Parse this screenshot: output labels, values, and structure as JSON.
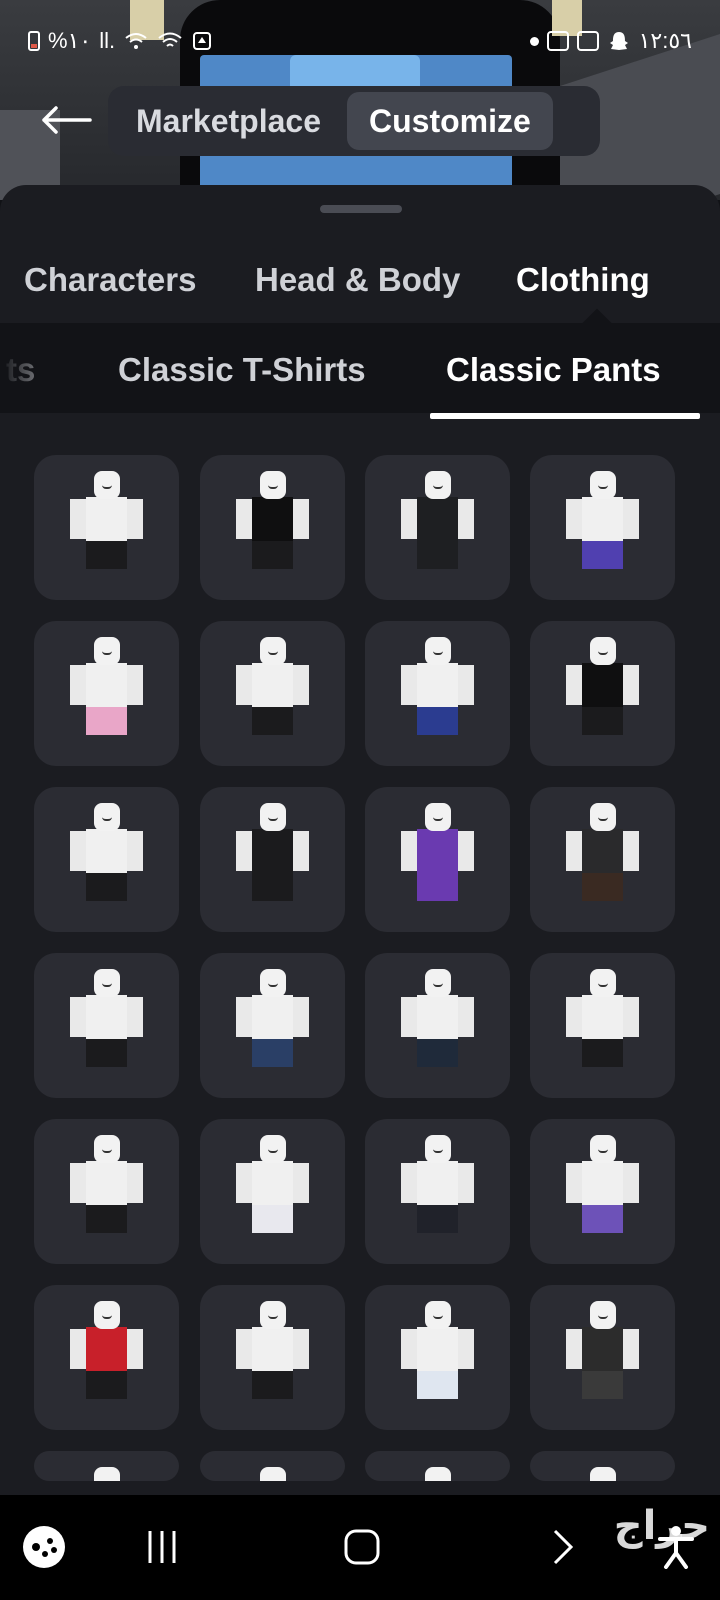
{
  "status_bar": {
    "battery_text": "%١٠",
    "signal_text": "ll.",
    "time": "١٢:٥٦"
  },
  "header": {
    "back_icon": "arrow-left-icon",
    "tabs": [
      {
        "label": "Marketplace",
        "active": false
      },
      {
        "label": "Customize",
        "active": true
      }
    ]
  },
  "categories": [
    {
      "label": "Characters",
      "active": false
    },
    {
      "label": "Head & Body",
      "active": false
    },
    {
      "label": "Clothing",
      "active": true
    }
  ],
  "subcategories": [
    {
      "label": "ts",
      "active": false
    },
    {
      "label": "Classic T-Shirts",
      "active": false
    },
    {
      "label": "Classic Pants",
      "active": true
    }
  ],
  "grid_items": [
    {
      "pants": "#1b1b1d",
      "torso": "#f0f0f0"
    },
    {
      "pants": "#1b1b1d",
      "torso": "#0f0f10"
    },
    {
      "pants": "#1e1f22",
      "torso": "#1e1f22"
    },
    {
      "pants": "#5040b0",
      "torso": "#f0f0f0"
    },
    {
      "pants": "#e9a6c8",
      "torso": "#f0f0f0"
    },
    {
      "pants": "#1b1b1d",
      "torso": "#f0f0f0"
    },
    {
      "pants": "#2b3c90",
      "torso": "#f0f0f0"
    },
    {
      "pants": "#1b1b1d",
      "torso": "#0f0f10"
    },
    {
      "pants": "#1b1b1d",
      "torso": "#f0f0f0"
    },
    {
      "pants": "#1b1b1d",
      "torso": "#1b1b1d"
    },
    {
      "pants": "#6a3ab0",
      "torso": "#6a3ab0"
    },
    {
      "pants": "#3a2a22",
      "torso": "#2a2a2c"
    },
    {
      "pants": "#1b1b1d",
      "torso": "#f0f0f0"
    },
    {
      "pants": "#2a3f66",
      "torso": "#f0f0f0"
    },
    {
      "pants": "#1f2a3a",
      "torso": "#f0f0f0"
    },
    {
      "pants": "#1b1b1d",
      "torso": "#f0f0f0"
    },
    {
      "pants": "#1b1b1d",
      "torso": "#f0f0f0"
    },
    {
      "pants": "#e8e8ee",
      "torso": "#f0f0f0"
    },
    {
      "pants": "#20222a",
      "torso": "#f0f0f0"
    },
    {
      "pants": "#6d52b8",
      "torso": "#f0f0f0"
    },
    {
      "pants": "#1b1b1d",
      "torso": "#c8202a"
    },
    {
      "pants": "#1b1b1d",
      "torso": "#f0f0f0"
    },
    {
      "pants": "#dfe6f0",
      "torso": "#f0f0f0"
    },
    {
      "pants": "#3a3a3a",
      "torso": "#2c2c2c"
    }
  ],
  "nav_bar": {
    "watermark": "حراج"
  },
  "colors": {
    "sheet_bg": "#1b1c21",
    "tile_bg": "#2b2c33",
    "active_tab_bg": "#43464f"
  }
}
